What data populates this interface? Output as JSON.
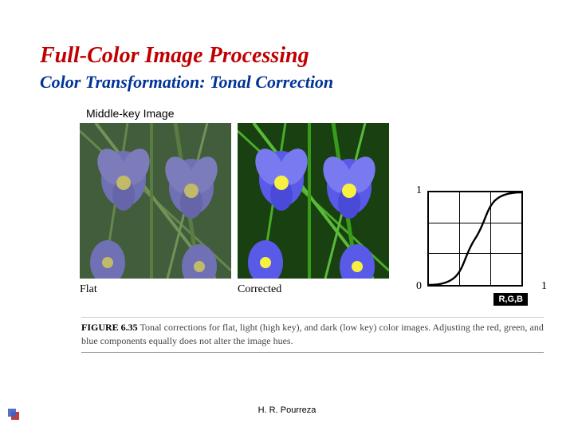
{
  "title": "Full-Color Image Processing",
  "subtitle": "Color Transformation: Tonal Correction",
  "image_label": "Middle-key Image",
  "img_caption_left": "Flat",
  "img_caption_right": "Corrected",
  "figure_number": "FIGURE 6.35",
  "figure_text": "Tonal corrections for flat, light (high key), and dark (low key) color images. Adjusting the red, green, and blue components equally does not alter the image hues.",
  "footer": "H. R. Pourreza",
  "chart_data": {
    "type": "line",
    "title": "",
    "xlabel": "",
    "ylabel": "",
    "xlim": [
      0,
      1
    ],
    "ylim": [
      0,
      1
    ],
    "series_label": "R,G,B",
    "axis_ticks": {
      "y0": "0",
      "y1": "1",
      "x1": "1"
    },
    "x": [
      0.0,
      0.1,
      0.2,
      0.3,
      0.4,
      0.5,
      0.6,
      0.7,
      0.8,
      0.9,
      1.0
    ],
    "y": [
      0.0,
      0.02,
      0.06,
      0.15,
      0.32,
      0.5,
      0.68,
      0.85,
      0.94,
      0.98,
      1.0
    ]
  }
}
